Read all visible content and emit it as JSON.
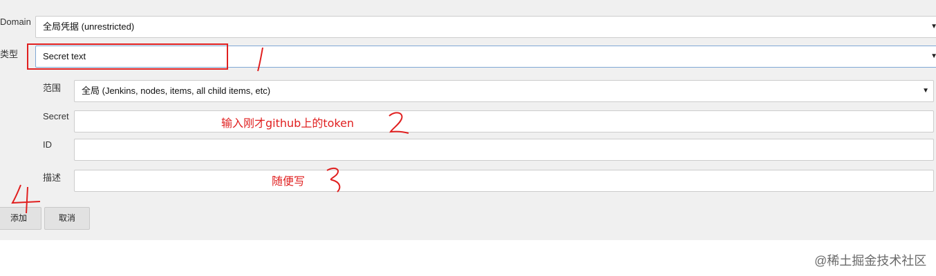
{
  "form": {
    "domain": {
      "label": "Domain",
      "value": "全局凭据 (unrestricted)"
    },
    "kind": {
      "label": "类型",
      "value": "Secret text"
    },
    "scope": {
      "label": "范围",
      "value": "全局 (Jenkins, nodes, items, all child items, etc)"
    },
    "secret": {
      "label": "Secret",
      "value": ""
    },
    "id": {
      "label": "ID",
      "value": ""
    },
    "description": {
      "label": "描述",
      "value": ""
    }
  },
  "buttons": {
    "add": "添加",
    "cancel": "取消"
  },
  "annotations": {
    "step1": "1",
    "step2_text": "输入刚才github上的token",
    "step2": "2",
    "step3_text": "随便写",
    "step3": "3",
    "step4": "4",
    "color": "#e01f1f"
  },
  "icons": {
    "select_caret": "▼"
  },
  "watermark": "@稀土掘金技术社区"
}
